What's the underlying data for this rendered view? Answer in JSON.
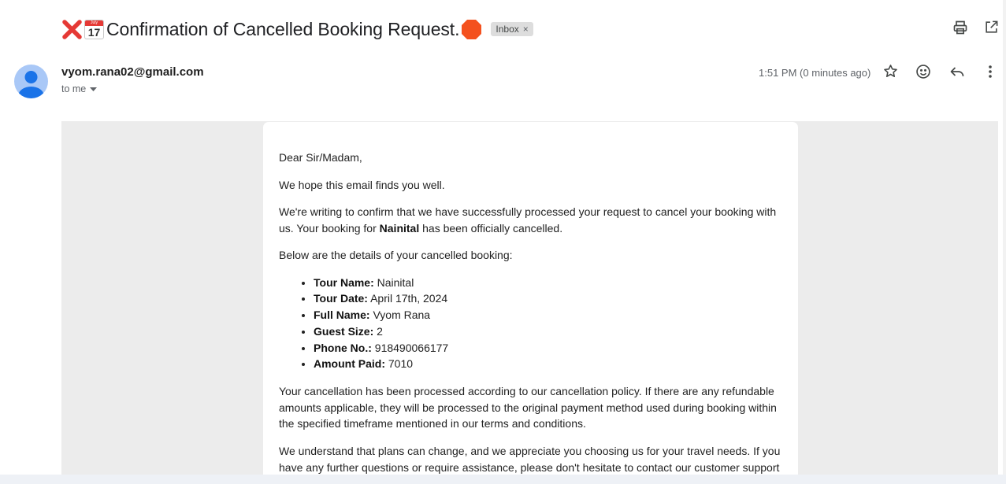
{
  "subject": {
    "title": "Confirmation of Cancelled Booking Request.",
    "calendar_month": "July",
    "calendar_day": "17",
    "label_chip": "Inbox",
    "label_remove": "×"
  },
  "header": {
    "sender": "vyom.rana02@gmail.com",
    "recipient": "to me",
    "time": "1:51 PM (0 minutes ago)"
  },
  "email": {
    "greeting": "Dear Sir/Madam,",
    "p1": "We hope this email finds you well.",
    "p2_before": "We're writing to confirm that we have successfully processed your request to cancel your booking with us. Your booking for ",
    "p2_bold": "Nainital",
    "p2_after": " has been officially cancelled.",
    "p3": "Below are the details of your cancelled booking:",
    "details": [
      {
        "label": "Tour Name:",
        "value": " Nainital"
      },
      {
        "label": "Tour Date:",
        "value": " April 17th, 2024"
      },
      {
        "label": "Full Name:",
        "value": " Vyom Rana"
      },
      {
        "label": "Guest Size:",
        "value": " 2"
      },
      {
        "label": "Phone No.:",
        "value": " 918490066177"
      },
      {
        "label": "Amount Paid:",
        "value": " 7010"
      }
    ],
    "p4": "Your cancellation has been processed according to our cancellation policy. If there are any refundable amounts applicable, they will be processed to the original payment method used during booking within the specified timeframe mentioned in our terms and conditions.",
    "p5": "We understand that plans can change, and we appreciate you choosing us for your travel needs. If you have any further questions or require assistance, please don't hesitate to contact our customer support"
  },
  "icons": {
    "subject_prefix": "cross-mark-icon",
    "calendar": "calendar-icon",
    "subject_suffix": "stop-sign-icon",
    "print": "print-icon",
    "new_window": "open-in-new-window-icon",
    "star": "star-icon",
    "emoji": "emoji-reaction-icon",
    "reply": "reply-icon",
    "more": "more-options-icon",
    "recipient_dropdown": "chevron-down-icon",
    "avatar": "default-avatar-icon"
  },
  "colors": {
    "cross": "#e53935",
    "stop": "#f4511e",
    "avatar_bg": "#a9c8f7",
    "avatar_fg": "#1a73e8",
    "body_bg": "#ececec",
    "chip_bg": "#dddddd"
  }
}
